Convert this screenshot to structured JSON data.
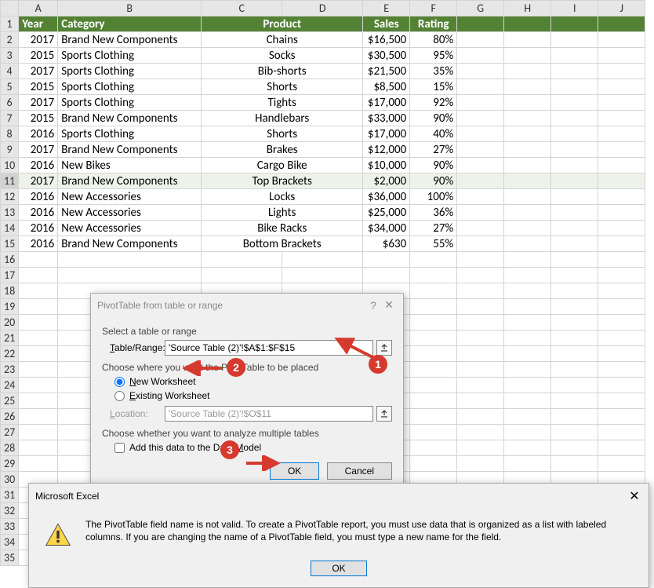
{
  "columns": [
    "A",
    "B",
    "C",
    "D",
    "E",
    "F",
    "G",
    "H",
    "I",
    "J"
  ],
  "headers": {
    "year": "Year",
    "category": "Category",
    "product": "Product",
    "sales": "Sales",
    "rating": "Rating"
  },
  "rows": [
    {
      "year": "2017",
      "category": "Brand New Components",
      "product": "Chains",
      "sales": "$16,500",
      "rating": "80%"
    },
    {
      "year": "2015",
      "category": "Sports Clothing",
      "product": "Socks",
      "sales": "$30,500",
      "rating": "95%"
    },
    {
      "year": "2017",
      "category": "Sports Clothing",
      "product": "Bib-shorts",
      "sales": "$21,500",
      "rating": "35%"
    },
    {
      "year": "2015",
      "category": "Sports Clothing",
      "product": "Shorts",
      "sales": "$8,500",
      "rating": "15%"
    },
    {
      "year": "2017",
      "category": "Sports Clothing",
      "product": "Tights",
      "sales": "$17,000",
      "rating": "92%"
    },
    {
      "year": "2015",
      "category": "Brand New Components",
      "product": "Handlebars",
      "sales": "$33,000",
      "rating": "90%"
    },
    {
      "year": "2016",
      "category": "Sports Clothing",
      "product": "Shorts",
      "sales": "$17,000",
      "rating": "40%"
    },
    {
      "year": "2017",
      "category": "Brand New Components",
      "product": "Brakes",
      "sales": "$12,000",
      "rating": "27%"
    },
    {
      "year": "2016",
      "category": "New Bikes",
      "product": "Cargo Bike",
      "sales": "$10,000",
      "rating": "90%"
    },
    {
      "year": "2017",
      "category": "Brand New Components",
      "product": "Top Brackets",
      "sales": "$2,000",
      "rating": "90%"
    },
    {
      "year": "2016",
      "category": "New Accessories",
      "product": "Locks",
      "sales": "$36,000",
      "rating": "100%"
    },
    {
      "year": "2016",
      "category": "New Accessories",
      "product": "Lights",
      "sales": "$25,000",
      "rating": "36%"
    },
    {
      "year": "2016",
      "category": "New Accessories",
      "product": "Bike Racks",
      "sales": "$34,000",
      "rating": "27%"
    },
    {
      "year": "2016",
      "category": "Brand New Components",
      "product": "Bottom Brackets",
      "sales": "$630",
      "rating": "55%"
    }
  ],
  "totalRows": 35,
  "selectedRow": 11,
  "dialog1": {
    "title": "PivotTable from table or range",
    "section1": "Select a table or range",
    "tableRangeLabel": "Table/Range:",
    "tableRangeValue": "'Source Table (2)'!$A$1:$F$15",
    "section2": "Choose where you want the PivotTable to be placed",
    "newWs": "New Worksheet",
    "existWs": "Existing Worksheet",
    "locationLabel": "Location:",
    "locationValue": "'Source Table (2)'!$O$11",
    "section3": "Choose whether you want to analyze multiple tables",
    "checkLabel": "Add this data to the Data Model",
    "ok": "OK",
    "cancel": "Cancel"
  },
  "dialog2": {
    "title": "Microsoft Excel",
    "message": "The PivotTable field name is not valid. To create a PivotTable report, you must use data that is organized as a list with labeled columns. If you are changing the name of a PivotTable field, you must type a new name for the field.",
    "ok": "OK"
  },
  "anno": {
    "b1": "1",
    "b2": "2",
    "b3": "3"
  }
}
